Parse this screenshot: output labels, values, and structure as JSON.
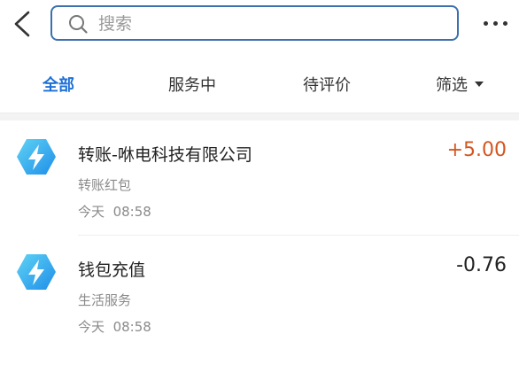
{
  "search": {
    "placeholder": "搜索",
    "value": ""
  },
  "tabs": [
    {
      "label": "全部",
      "active": true
    },
    {
      "label": "服务中",
      "active": false
    },
    {
      "label": "待评价",
      "active": false
    },
    {
      "label": "筛选",
      "active": false
    }
  ],
  "transactions": [
    {
      "title": "转账-咻电科技有限公司",
      "subtitle": "转账红包",
      "day": "今天",
      "time": "08:58",
      "amount": "+5.00",
      "amount_color": "#d4561f"
    },
    {
      "title": "钱包充值",
      "subtitle": "生活服务",
      "day": "今天",
      "time": "08:58",
      "amount": "-0.76",
      "amount_color": "#222222"
    }
  ],
  "icons": {
    "back": "chevron-left-icon",
    "search": "search-icon",
    "more": "more-dots-icon",
    "filter": "caret-down-icon",
    "logo": "lightning-bolt-icon"
  },
  "colors": {
    "accent": "#1d70d6",
    "positive": "#d4561f",
    "search_border": "#3d6fae"
  }
}
